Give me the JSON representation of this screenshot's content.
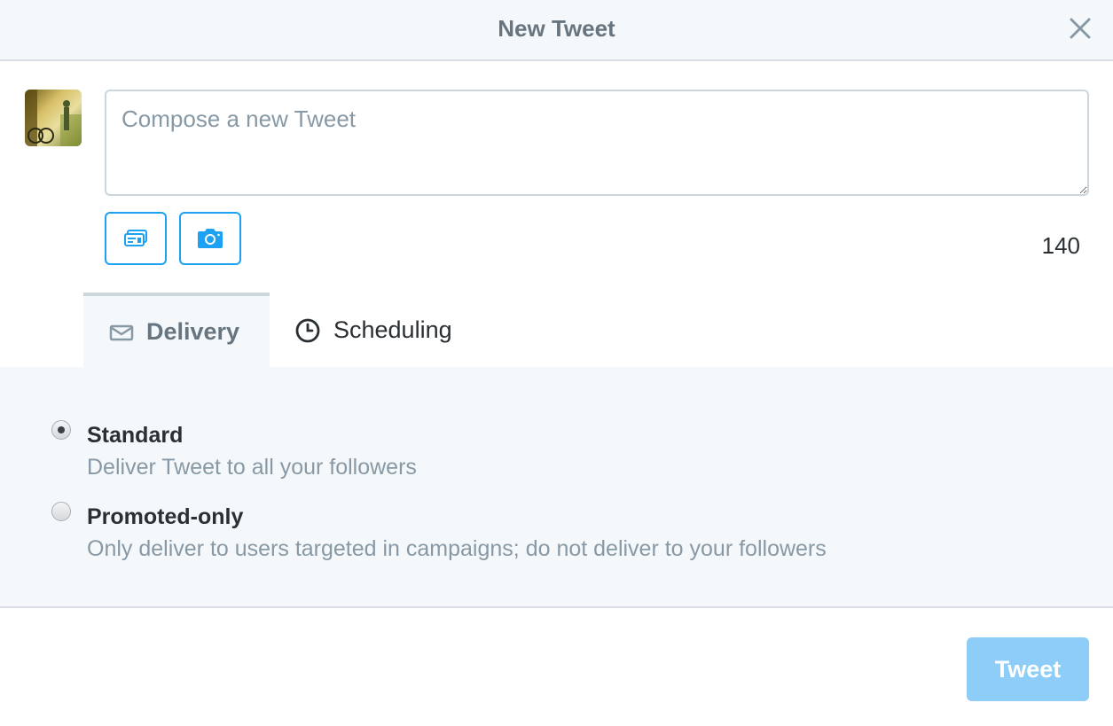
{
  "dialog": {
    "title": "New Tweet",
    "close_icon": "close-icon"
  },
  "compose": {
    "avatar_icon": "user-avatar",
    "placeholder": "Compose a new Tweet",
    "value": "",
    "card_icon": "website-card-icon",
    "photo_icon": "camera-icon",
    "char_count": "140"
  },
  "tabs": [
    {
      "label": "Delivery",
      "icon": "envelope-icon",
      "active": true
    },
    {
      "label": "Scheduling",
      "icon": "clock-icon",
      "active": false
    }
  ],
  "delivery": {
    "selected": "Standard",
    "options": [
      {
        "title": "Standard",
        "description": "Deliver Tweet to all your followers",
        "checked": true
      },
      {
        "title": "Promoted-only",
        "description": "Only deliver to users targeted in campaigns; do not deliver to your followers",
        "checked": false
      }
    ]
  },
  "footer": {
    "tweet_label": "Tweet",
    "tweet_disabled": true
  },
  "colors": {
    "accent": "#1da1f2",
    "tweet_disabled": "#8ecdf8",
    "panel_bg": "#f5f8fa",
    "muted_text": "#8899a6"
  }
}
